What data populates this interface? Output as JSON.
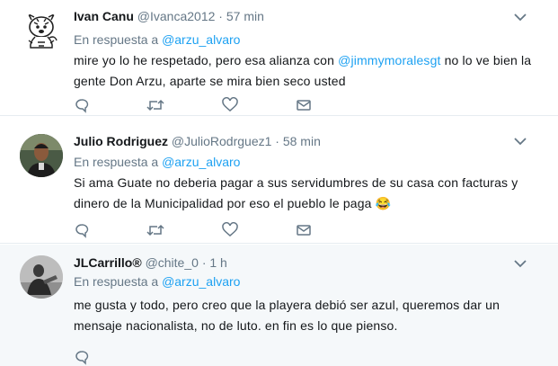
{
  "tweets": [
    {
      "name": "Ivan Canu",
      "handle": "@Ivanca2012",
      "sep": "·",
      "time": "57 min",
      "reply_prefix": "En respuesta a",
      "reply_to": "@arzu_alvaro",
      "text_a": "mire yo lo he respetado, pero esa alianza con ",
      "text_mention": "@jimmymoralesgt",
      "text_b": "  no lo ve bien la gente Don Arzu, aparte se mira bien seco usted",
      "avatar_icon": "tiger-mascot-avatar"
    },
    {
      "name": "Julio Rodriguez",
      "handle": "@JulioRodrguez1",
      "sep": "·",
      "time": "58 min",
      "reply_prefix": "En respuesta a",
      "reply_to": "@arzu_alvaro",
      "text": "Si ama Guate no deberia pagar a sus servidumbres de su casa con facturas y dinero de la Municipalidad por eso el pueblo le paga",
      "emoji": "😂",
      "avatar_icon": "person-photo-avatar"
    },
    {
      "name": "JLCarrillo®",
      "handle": "@chite_0",
      "sep": "·",
      "time": "1 h",
      "reply_prefix": "En respuesta a",
      "reply_to": "@arzu_alvaro",
      "text": "me gusta y todo, pero creo que la playera debió ser azul, queremos dar un mensaje nacionalista, no de luto. en fin es lo que pienso.",
      "avatar_icon": "person-photo-avatar"
    }
  ],
  "colors": {
    "link": "#1da1f2",
    "meta": "#657786",
    "highlight_bg": "#f5f8fa"
  },
  "action_icons": [
    "reply-icon",
    "retweet-icon",
    "like-icon",
    "direct-message-icon"
  ]
}
